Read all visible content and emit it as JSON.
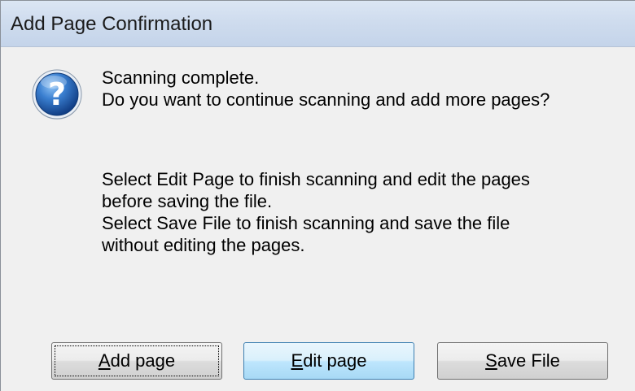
{
  "window": {
    "title": "Add Page Confirmation"
  },
  "icon": {
    "name": "question-icon",
    "color": "#1f5fb4"
  },
  "message": {
    "line1": "Scanning complete.",
    "line2": "Do you want to continue scanning and add more pages?",
    "line3": "Select Edit Page to finish scanning and edit the pages",
    "line4": "before saving the file.",
    "line5": "Select Save File to finish scanning and save the file",
    "line6": "without editing the pages."
  },
  "buttons": {
    "add": {
      "mnemonic": "A",
      "rest": "dd page"
    },
    "edit": {
      "mnemonic": "E",
      "rest": "dit page"
    },
    "save": {
      "mnemonic": "S",
      "rest": "ave File"
    }
  }
}
